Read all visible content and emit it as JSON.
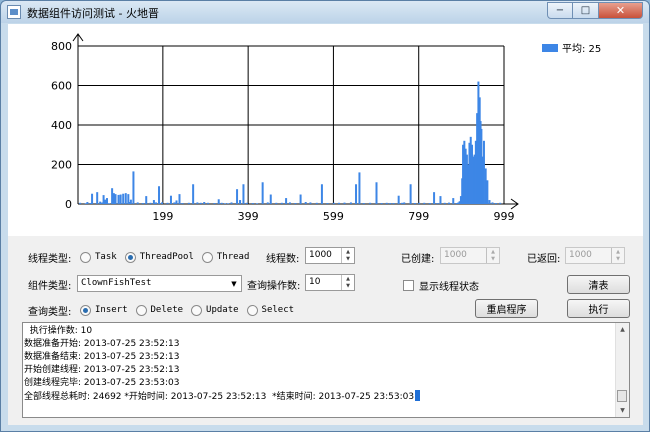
{
  "window": {
    "title": "数据组件访问测试 - 火地晋",
    "close_glyph": "✕",
    "max_glyph": "□",
    "min_glyph": "−"
  },
  "chart_data": {
    "type": "bar",
    "ylim": [
      0,
      800
    ],
    "xlim": [
      0,
      999
    ],
    "y_ticks": [
      0,
      200,
      400,
      600,
      800
    ],
    "x_ticks": [
      199,
      399,
      599,
      799,
      999
    ],
    "grid": true,
    "legend": {
      "label": "平均: 25",
      "placement": "top-right",
      "color": "#3d86e6"
    },
    "series": [
      {
        "color": "#3d86e6",
        "x": [
          5,
          18,
          22,
          30,
          33,
          45,
          52,
          57,
          60,
          64,
          68,
          73,
          80,
          84,
          88,
          95,
          100,
          106,
          112,
          118,
          120,
          124,
          130,
          140,
          152,
          160,
          170,
          178,
          183,
          190,
          197,
          210,
          218,
          226,
          231,
          238,
          245,
          260,
          270,
          280,
          288,
          296,
          305,
          320,
          330,
          337,
          345,
          352,
          360,
          373,
          380,
          388,
          396,
          410,
          420,
          433,
          445,
          452,
          465,
          478,
          488,
          497,
          510,
          522,
          534,
          545,
          560,
          572,
          585,
          600,
          612,
          625,
          640,
          652,
          660,
          670,
          685,
          700,
          712,
          724,
          732,
          740,
          752,
          760,
          765,
          780,
          790,
          800,
          812,
          825,
          835,
          843,
          850,
          860,
          870,
          880,
          888,
          892,
          895,
          898,
          901,
          903,
          906,
          909,
          912,
          915,
          918,
          921,
          924,
          927,
          930,
          933,
          936,
          939,
          942,
          944,
          946,
          948,
          952,
          956,
          960,
          965,
          972,
          980,
          990
        ],
        "values": [
          6,
          4,
          10,
          5,
          52,
          60,
          12,
          8,
          45,
          22,
          30,
          4,
          80,
          55,
          50,
          46,
          48,
          52,
          55,
          50,
          10,
          22,
          165,
          8,
          5,
          40,
          6,
          20,
          8,
          90,
          8,
          6,
          42,
          8,
          18,
          50,
          5,
          6,
          100,
          8,
          6,
          10,
          6,
          5,
          24,
          6,
          4,
          4,
          8,
          75,
          20,
          100,
          6,
          5,
          4,
          110,
          8,
          48,
          6,
          6,
          30,
          8,
          5,
          48,
          10,
          8,
          6,
          100,
          5,
          6,
          6,
          7,
          8,
          100,
          160,
          5,
          6,
          110,
          5,
          6,
          5,
          5,
          42,
          6,
          8,
          100,
          5,
          6,
          6,
          5,
          60,
          5,
          40,
          6,
          7,
          30,
          5,
          8,
          14,
          40,
          130,
          300,
          320,
          280,
          250,
          200,
          310,
          340,
          300,
          240,
          250,
          320,
          460,
          620,
          540,
          420,
          380,
          240,
          320,
          180,
          120,
          20,
          8,
          5,
          6
        ]
      }
    ]
  },
  "controls": {
    "thread_type_label": "线程类型:",
    "thread_options": [
      "Task",
      "ThreadPool",
      "Thread"
    ],
    "thread_count_label": "线程数:",
    "thread_count_value": "1000",
    "created_label": "已创建:",
    "created_value": "1000",
    "returned_label": "已返回:",
    "returned_value": "1000",
    "component_label": "组件类型:",
    "component_value": "ClownFishTest",
    "query_ops_label": "查询操作数:",
    "query_ops_value": "10",
    "show_state_label": "显示线程状态",
    "clear_button": "清表",
    "query_type_label": "查询类型:",
    "query_options": [
      "Insert",
      "Delete",
      "Update",
      "Select"
    ],
    "restart_button": "重启程序",
    "execute_button": "执行"
  },
  "log": {
    "lines": [
      "  执行操作数: 10",
      "数据准备开始: 2013-07-25 23:52:13",
      "数据准备结束: 2013-07-25 23:52:13",
      "开始创建线程: 2013-07-25 23:52:13",
      "创建线程完毕: 2013-07-25 23:53:03",
      "全部线程总耗时: 24692 *开始时间: 2013-07-25 23:52:13  *结束时间: 2013-07-25 23:53:03"
    ]
  }
}
